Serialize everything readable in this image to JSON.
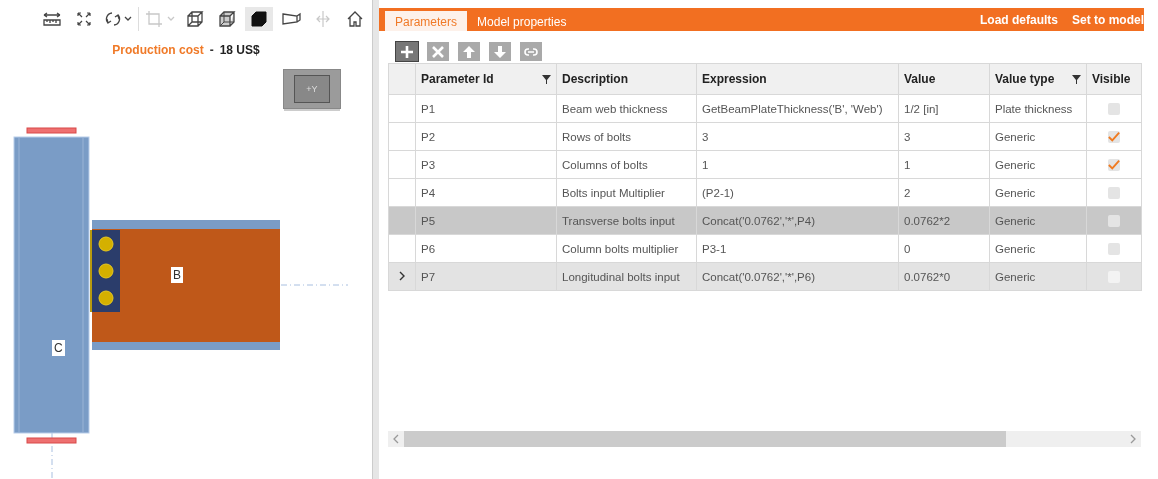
{
  "toolbar": [
    {
      "kind": "measure",
      "selected": false,
      "disabled": false
    },
    {
      "kind": "fit",
      "selected": false,
      "disabled": false
    },
    {
      "kind": "rotate",
      "selected": false,
      "disabled": false
    },
    {
      "kind": "crop",
      "selected": false,
      "disabled": true
    },
    {
      "kind": "wireframe",
      "selected": false,
      "disabled": false
    },
    {
      "kind": "transparent",
      "selected": false,
      "disabled": false
    },
    {
      "kind": "solid",
      "selected": true,
      "disabled": false
    },
    {
      "kind": "section",
      "selected": false,
      "disabled": false
    },
    {
      "kind": "axis",
      "selected": false,
      "disabled": true
    },
    {
      "kind": "home",
      "selected": false,
      "disabled": false
    }
  ],
  "cost": {
    "label": "Production cost",
    "separator": "-",
    "value": "18 US$"
  },
  "view_cube": {
    "label": "+Y"
  },
  "diagram": {
    "column_label": "C",
    "beam_label": "B"
  },
  "tabs": [
    {
      "label": "Parameters",
      "selected": true
    },
    {
      "label": "Model properties",
      "selected": false
    }
  ],
  "header_actions": [
    "Load defaults",
    "Set to model"
  ],
  "grid_tools": [
    {
      "kind": "add",
      "active": true
    },
    {
      "kind": "delete",
      "active": false
    },
    {
      "kind": "up",
      "active": false
    },
    {
      "kind": "down",
      "active": false
    },
    {
      "kind": "link",
      "active": false
    }
  ],
  "table": {
    "columns": [
      {
        "label": "Parameter Id",
        "filter": true
      },
      {
        "label": "Description",
        "filter": false
      },
      {
        "label": "Expression",
        "filter": false
      },
      {
        "label": "Value",
        "filter": false
      },
      {
        "label": "Value type",
        "filter": true
      },
      {
        "label": "Visible",
        "filter": false
      }
    ],
    "rows": [
      {
        "id": "P1",
        "description": "Beam web thickness",
        "expression": "GetBeamPlateThickness('B', 'Web')",
        "value": "1/2 [in]",
        "value_type": "Plate thickness",
        "visible": false,
        "selected": false,
        "current": false
      },
      {
        "id": "P2",
        "description": "Rows of bolts",
        "expression": "3",
        "value": "3",
        "value_type": "Generic",
        "visible": true,
        "selected": false,
        "current": false
      },
      {
        "id": "P3",
        "description": "Columns of bolts",
        "expression": "1",
        "value": "1",
        "value_type": "Generic",
        "visible": true,
        "selected": false,
        "current": false
      },
      {
        "id": "P4",
        "description": "Bolts input Multiplier",
        "expression": "(P2-1)",
        "value": "2",
        "value_type": "Generic",
        "visible": false,
        "selected": false,
        "current": false
      },
      {
        "id": "P5",
        "description": "Transverse bolts input",
        "expression": "Concat('0.0762','*',P4)",
        "value": "0.0762*2",
        "value_type": "Generic",
        "visible": false,
        "selected": true,
        "current": false
      },
      {
        "id": "P6",
        "description": "Column bolts multiplier",
        "expression": "P3-1",
        "value": "0",
        "value_type": "Generic",
        "visible": false,
        "selected": false,
        "current": false
      },
      {
        "id": "P7",
        "description": "Longitudinal bolts input",
        "expression": "Concat('0.0762','*',P6)",
        "value": "0.0762*0",
        "value_type": "Generic",
        "visible": false,
        "selected": false,
        "current": true
      }
    ]
  }
}
